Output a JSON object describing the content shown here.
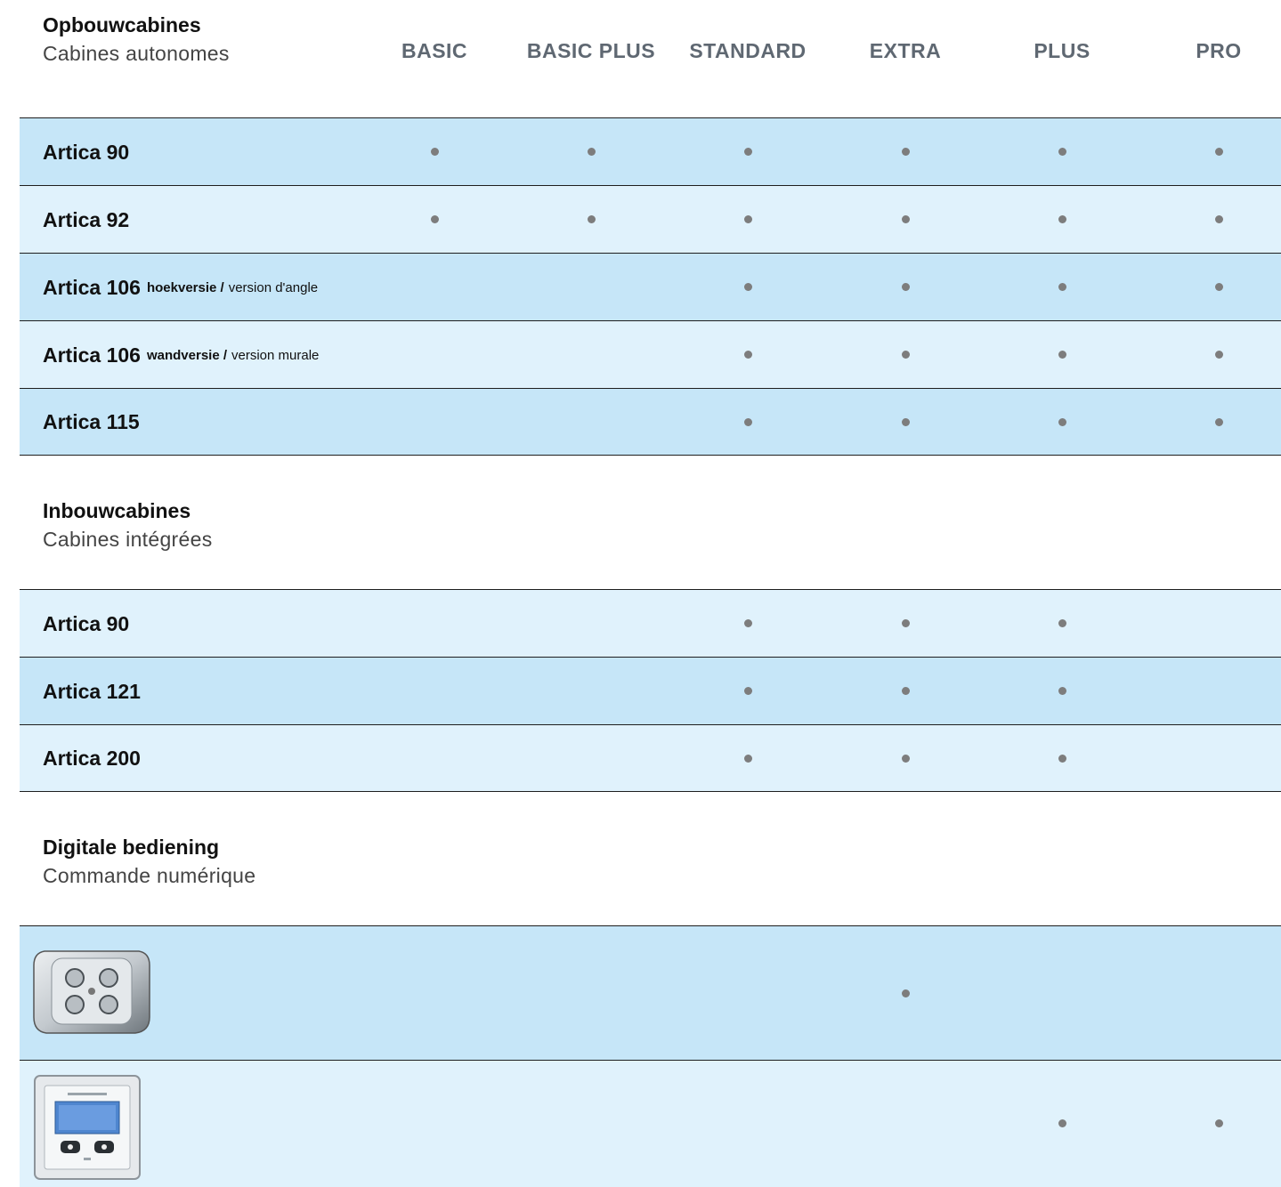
{
  "columns": [
    "BASIC",
    "BASIC PLUS",
    "STANDARD",
    "EXTRA",
    "PLUS",
    "PRO"
  ],
  "sections": [
    {
      "title": "Opbouwcabines",
      "subtitle": "Cabines autonomes",
      "rows": [
        {
          "name": "Artica 90",
          "marks": [
            true,
            true,
            true,
            true,
            true,
            true
          ]
        },
        {
          "name": "Artica 92",
          "marks": [
            true,
            true,
            true,
            true,
            true,
            true
          ]
        },
        {
          "name": "Artica 106",
          "variant_nl": "hoekversie /",
          "variant_fr": "version d'angle",
          "marks": [
            false,
            false,
            true,
            true,
            true,
            true
          ]
        },
        {
          "name": "Artica 106",
          "variant_nl": "wandversie /",
          "variant_fr": "version murale",
          "marks": [
            false,
            false,
            true,
            true,
            true,
            true
          ]
        },
        {
          "name": "Artica 115",
          "marks": [
            false,
            false,
            true,
            true,
            true,
            true
          ]
        }
      ]
    },
    {
      "title": "Inbouwcabines",
      "subtitle": "Cabines intégrées",
      "rows": [
        {
          "name": "Artica 90",
          "marks": [
            false,
            false,
            true,
            true,
            true,
            false
          ]
        },
        {
          "name": "Artica 121",
          "marks": [
            false,
            false,
            true,
            true,
            true,
            false
          ]
        },
        {
          "name": "Artica 200",
          "marks": [
            false,
            false,
            true,
            true,
            true,
            false
          ]
        }
      ]
    },
    {
      "title": "Digitale bediening",
      "subtitle": "Commande numérique",
      "rows": [
        {
          "image": "rotary-control-panel-image",
          "marks": [
            false,
            false,
            false,
            true,
            false,
            false
          ]
        },
        {
          "image": "digital-display-panel-image",
          "marks": [
            false,
            false,
            false,
            false,
            true,
            true
          ]
        }
      ]
    }
  ]
}
